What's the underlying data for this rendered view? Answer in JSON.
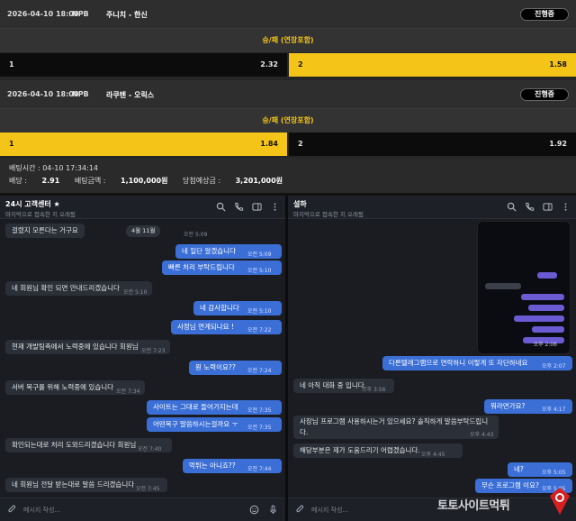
{
  "bets": [
    {
      "date": "2026-04-10 18:00",
      "league": "NPB",
      "teams": "주니치 - 한신",
      "status": "진행중",
      "market": "승/패 (연장포함)",
      "home": {
        "side": "1",
        "odd": "2.32"
      },
      "away": {
        "side": "2",
        "odd": "1.58"
      },
      "selected": "away"
    },
    {
      "date": "2026-04-10 18:00",
      "league": "NPB",
      "teams": "라쿠텐 - 오릭스",
      "status": "진행중",
      "market": "승/패 (연장포함)",
      "home": {
        "side": "1",
        "odd": "1.84"
      },
      "away": {
        "side": "2",
        "odd": "1.92"
      },
      "selected": "home"
    }
  ],
  "bet_info": {
    "time_label": "배팅시간 : 04-10 17:34:14",
    "odds_label": "배당 :",
    "odds_value": "2.91",
    "amount_label": "배팅금액 :",
    "amount_value": "1,100,000원",
    "payout_label": "당첨예상금 :",
    "payout_value": "3,201,000원"
  },
  "left_chat": {
    "name": "24시 고객센터 ★",
    "subtitle": "마지막으로 접속한 지 오래됨",
    "date_pill": "4월 11월",
    "placeholder": "메시지 작성...",
    "messages": [
      {
        "dir": "in",
        "text": "걸렸지 모른다는 거구요",
        "time": "오전 5:09"
      },
      {
        "dir": "out",
        "text": "네 일단 알겠습니다",
        "time": "오전 5:09"
      },
      {
        "dir": "out",
        "text": "빠른 처리 부탁드립니다",
        "time": "오전 5:10"
      },
      {
        "dir": "in",
        "text": "네 회원님 확인 되면 안내드리겠습니다",
        "time": "오전 5:10"
      },
      {
        "dir": "out",
        "text": "네 감사합니다",
        "time": "오전 5:10"
      },
      {
        "dir": "out",
        "text": "사정님 연계되나요 !",
        "time": "오전 7:22"
      },
      {
        "dir": "in",
        "text": "현재 개발팀측에서 노력중에 있습니다 회원님",
        "time": "오전 7:23"
      },
      {
        "dir": "out",
        "text": "뭔 노력이요??",
        "time": "오전 7:24"
      },
      {
        "dir": "in",
        "text": "서버 복구를 위해 노력중에 있습니다",
        "time": "오전 7:34"
      },
      {
        "dir": "out",
        "text": "사이트는 그대로 들어가지는데",
        "time": "오전 7:35"
      },
      {
        "dir": "out",
        "text": "어떤복구 말씀하시는걸까요 ㅜ",
        "time": "오전 7:35"
      },
      {
        "dir": "in",
        "text": "확인되는대로 처리 도와드리겠습니다 회원님",
        "time": "오전 7:40"
      },
      {
        "dir": "out",
        "text": "먹튀는 아니죠??",
        "time": "오전 7:44"
      },
      {
        "dir": "in",
        "text": "네 회원님 전달 받는대로 말씀 드리겠습니다",
        "time": "오전 7:45"
      }
    ]
  },
  "right_chat": {
    "name": "설하",
    "subtitle": "마지막으로 접속한 지 오래됨",
    "shot_time": "오후 2:06",
    "placeholder": "메시지 작성...",
    "messages": [
      {
        "dir": "out",
        "text": "다른텔레그램으로 연락하니 이렇게 또 자단하네요",
        "time": "오후 2:07"
      },
      {
        "dir": "in",
        "text": "네 아직 대화 중 입니다.",
        "time": "오후 3:56"
      },
      {
        "dir": "out",
        "text": "뭐라면가요?",
        "time": "오후 4:17"
      },
      {
        "dir": "in",
        "text": "사장님 프로그램 사용하시는거 있으세요? 솔직하게 말씀부탁드립니다.",
        "time": "오후 4:43"
      },
      {
        "dir": "in",
        "text": "해당부분은 제가 도움드리기 어렵겠습니다.",
        "time": "오후 4:45"
      },
      {
        "dir": "out",
        "text": "네?",
        "time": "오후 5:05"
      },
      {
        "dir": "out",
        "text": "무슨 프로그램 이요?",
        "time": "오후 5:05"
      }
    ]
  },
  "watermark": {
    "text": "토토사이트먹튀"
  },
  "colors": {
    "accent": "#f4c418",
    "bubble_out": "#3b6fd6",
    "bubble_in": "#2b2f38"
  },
  "icons": [
    "search-icon",
    "phone-icon",
    "sidebar-icon",
    "more-icon",
    "paperclip-icon",
    "emoji-icon",
    "mic-icon",
    "verified-star-icon"
  ]
}
